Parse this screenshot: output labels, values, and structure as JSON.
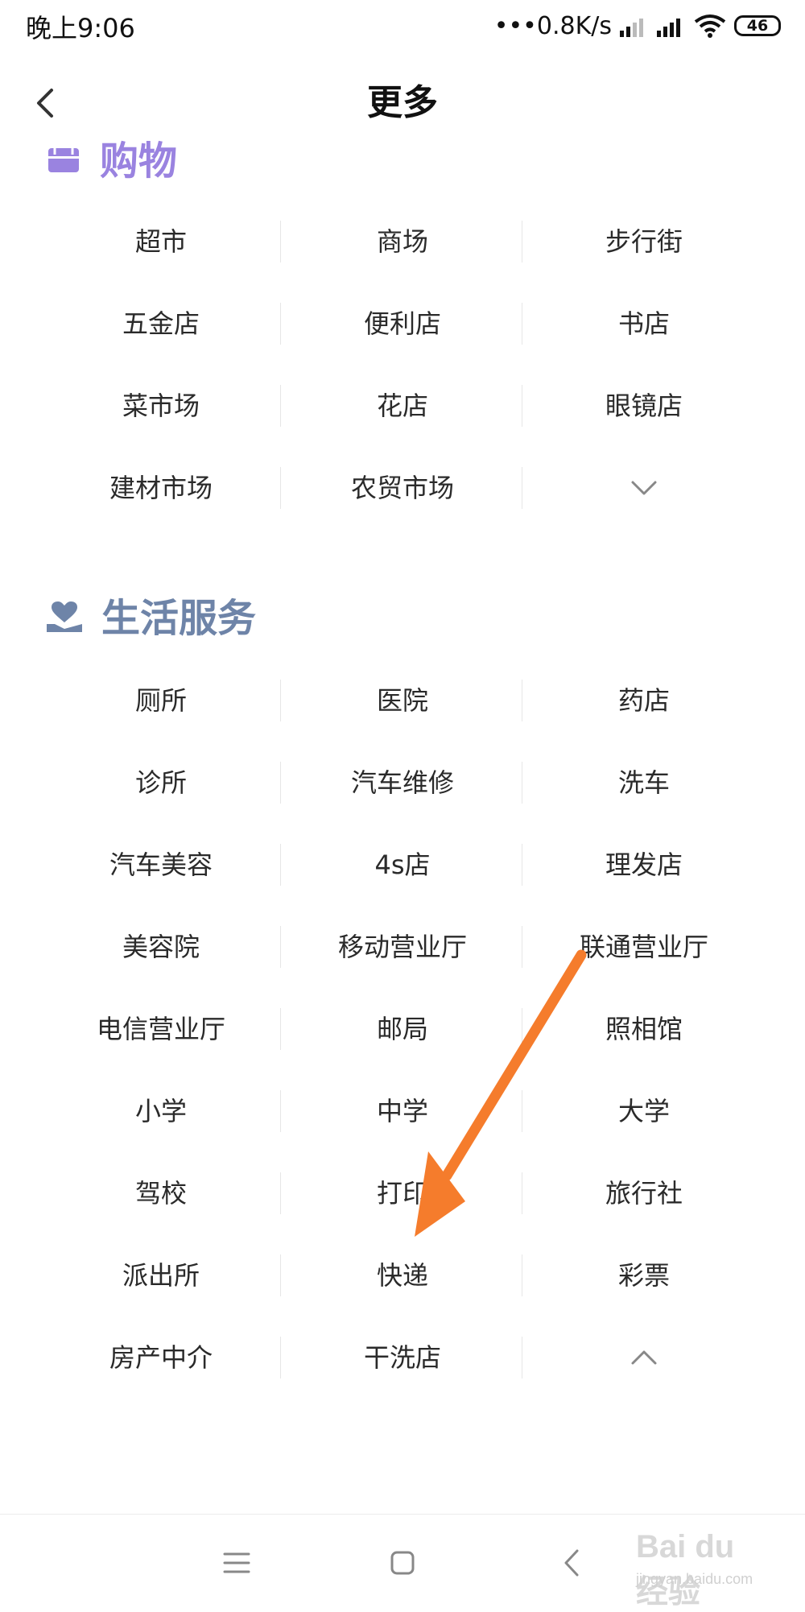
{
  "status_bar": {
    "time": "晚上9:06",
    "speed": "•••0.8K/s",
    "battery": "46"
  },
  "header": {
    "title": "更多"
  },
  "sections": [
    {
      "title": "购物",
      "icon": "shopping-bag-icon",
      "color": "#9a83e0",
      "rows": [
        [
          "超市",
          "商场",
          "步行街"
        ],
        [
          "五金店",
          "便利店",
          "书店"
        ],
        [
          "菜市场",
          "花店",
          "眼镜店"
        ],
        [
          "建材市场",
          "农贸市场",
          ""
        ]
      ]
    },
    {
      "title": "生活服务",
      "icon": "heart-hand-icon",
      "color": "#6e84a8",
      "rows": [
        [
          "厕所",
          "医院",
          "药店"
        ],
        [
          "诊所",
          "汽车维修",
          "洗车"
        ],
        [
          "汽车美容",
          "4s店",
          "理发店"
        ],
        [
          "美容院",
          "移动营业厅",
          "联通营业厅"
        ],
        [
          "电信营业厅",
          "邮局",
          "照相馆"
        ],
        [
          "小学",
          "中学",
          "大学"
        ],
        [
          "驾校",
          "打印",
          "旅行社"
        ],
        [
          "派出所",
          "快递",
          "彩票"
        ],
        [
          "房产中介",
          "干洗店",
          ""
        ]
      ]
    }
  ],
  "watermark": {
    "text": "Bai du 经验",
    "sub": "jingyan.baidu.com"
  },
  "colors": {
    "annotation_arrow": "#f57c2c"
  }
}
